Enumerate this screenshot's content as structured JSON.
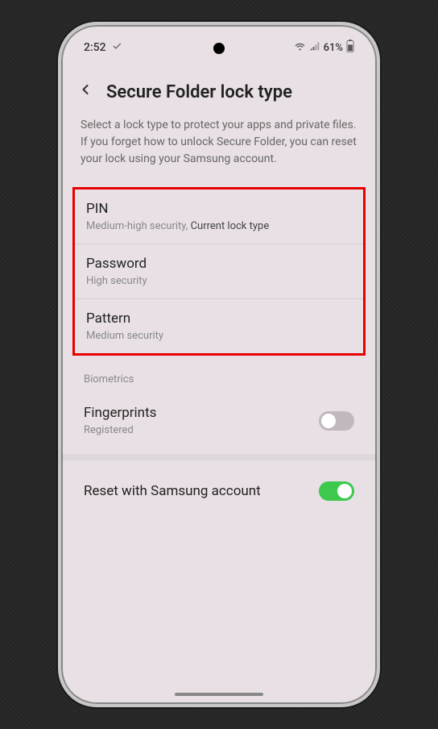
{
  "statusBar": {
    "time": "2:52",
    "battery": "61%"
  },
  "header": {
    "title": "Secure Folder lock type"
  },
  "description": "Select a lock type to protect your apps and private files. If you forget how to unlock Secure Folder, you can reset your lock using your Samsung account.",
  "lockOptions": [
    {
      "title": "PIN",
      "subtitle": "Medium-high security,",
      "current": "Current lock type"
    },
    {
      "title": "Password",
      "subtitle": "High security"
    },
    {
      "title": "Pattern",
      "subtitle": "Medium security"
    }
  ],
  "sections": {
    "biometricsLabel": "Biometrics",
    "fingerprints": {
      "title": "Fingerprints",
      "subtitle": "Registered",
      "enabled": false
    },
    "resetSamsung": {
      "title": "Reset with Samsung account",
      "enabled": true
    }
  }
}
